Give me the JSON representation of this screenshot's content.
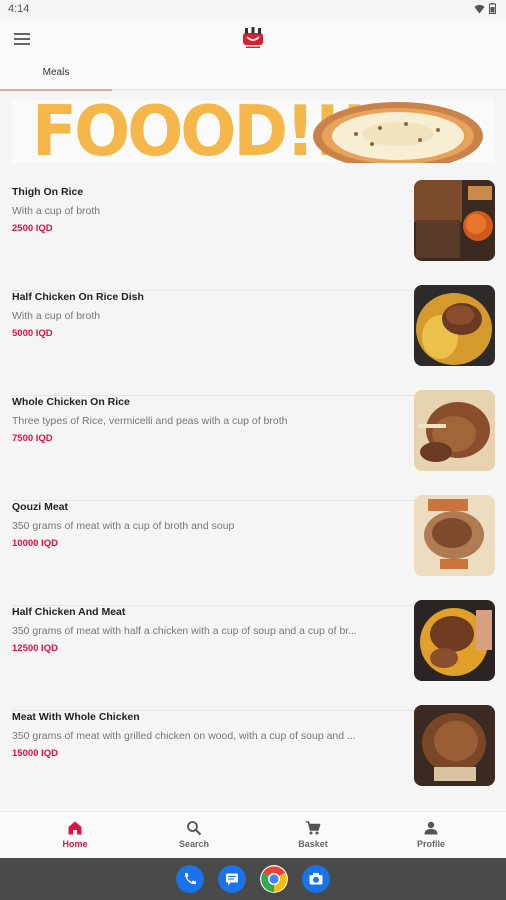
{
  "status_bar": {
    "time": "4:14"
  },
  "tabs": [
    {
      "label": "Meals"
    }
  ],
  "banner": {
    "text": "FOOOD!!!"
  },
  "menu_items": [
    {
      "name": "Thigh On Rice",
      "description": "With a cup of broth",
      "price": "2500 IQD"
    },
    {
      "name": "Half Chicken On Rice Dish",
      "description": "With a cup of broth",
      "price": "5000 IQD"
    },
    {
      "name": "Whole Chicken On Rice",
      "description": "Three types of Rice, vermicelli and peas with a cup of broth",
      "price": "7500 IQD"
    },
    {
      "name": "Qouzi Meat",
      "description": "350 grams of meat with a cup of broth and soup",
      "price": "10000 IQD"
    },
    {
      "name": "Half Chicken And Meat",
      "description": "350 grams of meat with half a chicken with a cup of soup and a cup of br...",
      "price": "12500 IQD"
    },
    {
      "name": "Meat With Whole Chicken",
      "description": "350 grams of meat with grilled chicken on wood, with a cup of soup and ...",
      "price": "15000 IQD"
    }
  ],
  "bottom_nav": [
    {
      "label": "Home",
      "icon": "home-icon",
      "active": true
    },
    {
      "label": "Search",
      "icon": "search-icon",
      "active": false
    },
    {
      "label": "Basket",
      "icon": "basket-icon",
      "active": false
    },
    {
      "label": "Profile",
      "icon": "profile-icon",
      "active": false
    }
  ],
  "dock": [
    {
      "icon": "phone-icon"
    },
    {
      "icon": "messages-icon"
    },
    {
      "icon": "chrome-icon"
    },
    {
      "icon": "camera-icon"
    }
  ],
  "colors": {
    "accent": "#e0123e",
    "banner_text": "#f5b64a",
    "system_bar": "#4a4a4a"
  }
}
